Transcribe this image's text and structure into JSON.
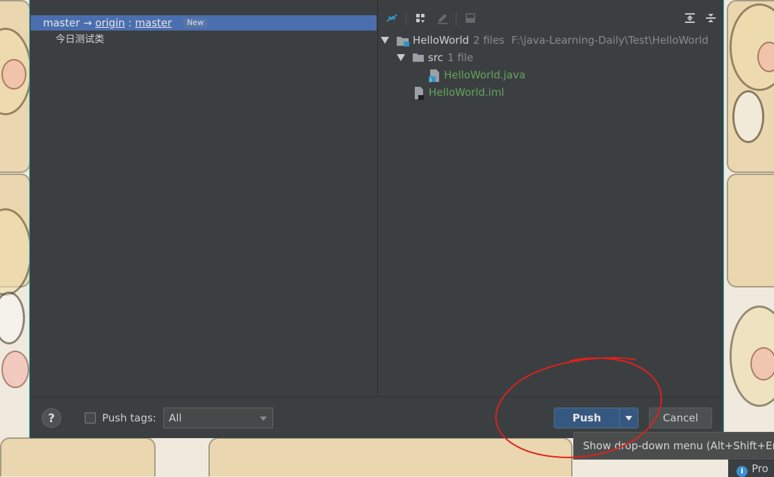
{
  "dialog": {
    "branch": {
      "local": "master",
      "arrow": "→",
      "remote": "origin",
      "separator": ":",
      "remote_branch": "master",
      "badge": "New"
    },
    "commit": {
      "message": "今日测试类"
    },
    "tree": {
      "root": {
        "name": "HelloWorld",
        "meta": "2 files",
        "path": "F:\\java-Learning-Daily\\Test\\HelloWorld"
      },
      "src": {
        "name": "src",
        "meta": "1 file"
      },
      "java_file": {
        "name": "HelloWorld.java"
      },
      "iml_file": {
        "name": "HelloWorld.iml"
      }
    },
    "footer": {
      "help": "?",
      "push_tags_label": "Push tags:",
      "push_tags_checked": false,
      "push_tags_value": "All",
      "push_label": "Push",
      "cancel_label": "Cancel"
    }
  },
  "tooltip": {
    "text": "Show drop-down menu (Alt+Shift+Enter)"
  },
  "statusbar": {
    "text": "Pro"
  },
  "colors": {
    "dialog_bg": "#3c3f41",
    "selection": "#4b6eaf",
    "push_button": "#365880",
    "file_added": "#62a55b",
    "annotation": "#e0201e",
    "dialog_border": "#1fa7b2"
  },
  "icons": [
    "collapse-arrows-icon",
    "group-by-icon",
    "edit-icon",
    "preview-icon",
    "expand-all-icon",
    "collapse-all-icon",
    "folder-icon",
    "java-file-icon",
    "iml-file-icon",
    "info-icon"
  ]
}
